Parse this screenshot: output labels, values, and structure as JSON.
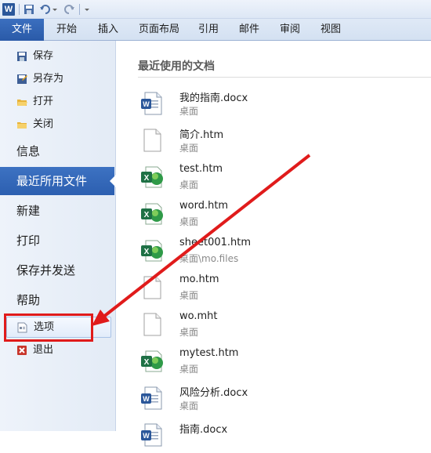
{
  "tabs": {
    "file": "文件",
    "items": [
      "开始",
      "插入",
      "页面布局",
      "引用",
      "邮件",
      "审阅",
      "视图"
    ]
  },
  "nav": {
    "save": "保存",
    "save_as": "另存为",
    "open": "打开",
    "close": "关闭",
    "info": "信息",
    "recent": "最近所用文件",
    "new": "新建",
    "print": "打印",
    "save_send": "保存并发送",
    "help": "帮助",
    "options": "选项",
    "exit": "退出"
  },
  "main": {
    "heading": "最近使用的文档",
    "documents": [
      {
        "name": "我的指南.docx",
        "path": "桌面",
        "icon": "word-doc-icon"
      },
      {
        "name": "简介.htm",
        "path": "桌面",
        "icon": "blank-file-icon"
      },
      {
        "name": "test.htm",
        "path": "桌面",
        "icon": "excel-file-icon"
      },
      {
        "name": "word.htm",
        "path": "桌面",
        "icon": "excel-file-icon"
      },
      {
        "name": "sheet001.htm",
        "path": "桌面\\mo.files",
        "icon": "excel-file-icon"
      },
      {
        "name": "mo.htm",
        "path": "桌面",
        "icon": "blank-file-icon"
      },
      {
        "name": "wo.mht",
        "path": "桌面",
        "icon": "blank-file-icon"
      },
      {
        "name": "mytest.htm",
        "path": "桌面",
        "icon": "excel-file-icon"
      },
      {
        "name": "风险分析.docx",
        "path": "桌面",
        "icon": "word-doc-icon"
      },
      {
        "name": "指南.docx",
        "path": "",
        "icon": "word-doc-icon"
      }
    ]
  },
  "colors": {
    "accent": "#2c5fb0",
    "annotation": "#e01b1b",
    "excel": "#1e7145",
    "word": "#2b579a"
  }
}
